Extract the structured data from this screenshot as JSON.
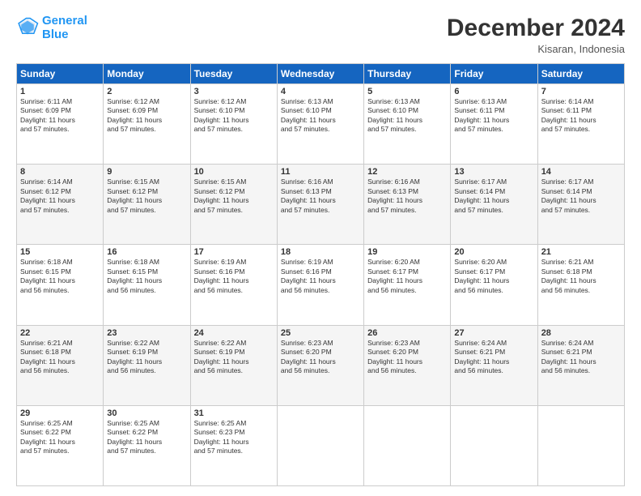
{
  "logo": {
    "line1": "General",
    "line2": "Blue",
    "icon_color": "#2196F3"
  },
  "title": "December 2024",
  "subtitle": "Kisaran, Indonesia",
  "headers": [
    "Sunday",
    "Monday",
    "Tuesday",
    "Wednesday",
    "Thursday",
    "Friday",
    "Saturday"
  ],
  "weeks": [
    [
      {
        "day": "1",
        "sunrise": "6:11 AM",
        "sunset": "6:09 PM",
        "daylight": "11 hours and 57 minutes."
      },
      {
        "day": "2",
        "sunrise": "6:12 AM",
        "sunset": "6:09 PM",
        "daylight": "11 hours and 57 minutes."
      },
      {
        "day": "3",
        "sunrise": "6:12 AM",
        "sunset": "6:10 PM",
        "daylight": "11 hours and 57 minutes."
      },
      {
        "day": "4",
        "sunrise": "6:13 AM",
        "sunset": "6:10 PM",
        "daylight": "11 hours and 57 minutes."
      },
      {
        "day": "5",
        "sunrise": "6:13 AM",
        "sunset": "6:10 PM",
        "daylight": "11 hours and 57 minutes."
      },
      {
        "day": "6",
        "sunrise": "6:13 AM",
        "sunset": "6:11 PM",
        "daylight": "11 hours and 57 minutes."
      },
      {
        "day": "7",
        "sunrise": "6:14 AM",
        "sunset": "6:11 PM",
        "daylight": "11 hours and 57 minutes."
      }
    ],
    [
      {
        "day": "8",
        "sunrise": "6:14 AM",
        "sunset": "6:12 PM",
        "daylight": "11 hours and 57 minutes."
      },
      {
        "day": "9",
        "sunrise": "6:15 AM",
        "sunset": "6:12 PM",
        "daylight": "11 hours and 57 minutes."
      },
      {
        "day": "10",
        "sunrise": "6:15 AM",
        "sunset": "6:12 PM",
        "daylight": "11 hours and 57 minutes."
      },
      {
        "day": "11",
        "sunrise": "6:16 AM",
        "sunset": "6:13 PM",
        "daylight": "11 hours and 57 minutes."
      },
      {
        "day": "12",
        "sunrise": "6:16 AM",
        "sunset": "6:13 PM",
        "daylight": "11 hours and 57 minutes."
      },
      {
        "day": "13",
        "sunrise": "6:17 AM",
        "sunset": "6:14 PM",
        "daylight": "11 hours and 57 minutes."
      },
      {
        "day": "14",
        "sunrise": "6:17 AM",
        "sunset": "6:14 PM",
        "daylight": "11 hours and 57 minutes."
      }
    ],
    [
      {
        "day": "15",
        "sunrise": "6:18 AM",
        "sunset": "6:15 PM",
        "daylight": "11 hours and 56 minutes."
      },
      {
        "day": "16",
        "sunrise": "6:18 AM",
        "sunset": "6:15 PM",
        "daylight": "11 hours and 56 minutes."
      },
      {
        "day": "17",
        "sunrise": "6:19 AM",
        "sunset": "6:16 PM",
        "daylight": "11 hours and 56 minutes."
      },
      {
        "day": "18",
        "sunrise": "6:19 AM",
        "sunset": "6:16 PM",
        "daylight": "11 hours and 56 minutes."
      },
      {
        "day": "19",
        "sunrise": "6:20 AM",
        "sunset": "6:17 PM",
        "daylight": "11 hours and 56 minutes."
      },
      {
        "day": "20",
        "sunrise": "6:20 AM",
        "sunset": "6:17 PM",
        "daylight": "11 hours and 56 minutes."
      },
      {
        "day": "21",
        "sunrise": "6:21 AM",
        "sunset": "6:18 PM",
        "daylight": "11 hours and 56 minutes."
      }
    ],
    [
      {
        "day": "22",
        "sunrise": "6:21 AM",
        "sunset": "6:18 PM",
        "daylight": "11 hours and 56 minutes."
      },
      {
        "day": "23",
        "sunrise": "6:22 AM",
        "sunset": "6:19 PM",
        "daylight": "11 hours and 56 minutes."
      },
      {
        "day": "24",
        "sunrise": "6:22 AM",
        "sunset": "6:19 PM",
        "daylight": "11 hours and 56 minutes."
      },
      {
        "day": "25",
        "sunrise": "6:23 AM",
        "sunset": "6:20 PM",
        "daylight": "11 hours and 56 minutes."
      },
      {
        "day": "26",
        "sunrise": "6:23 AM",
        "sunset": "6:20 PM",
        "daylight": "11 hours and 56 minutes."
      },
      {
        "day": "27",
        "sunrise": "6:24 AM",
        "sunset": "6:21 PM",
        "daylight": "11 hours and 56 minutes."
      },
      {
        "day": "28",
        "sunrise": "6:24 AM",
        "sunset": "6:21 PM",
        "daylight": "11 hours and 56 minutes."
      }
    ],
    [
      {
        "day": "29",
        "sunrise": "6:25 AM",
        "sunset": "6:22 PM",
        "daylight": "11 hours and 57 minutes."
      },
      {
        "day": "30",
        "sunrise": "6:25 AM",
        "sunset": "6:22 PM",
        "daylight": "11 hours and 57 minutes."
      },
      {
        "day": "31",
        "sunrise": "6:25 AM",
        "sunset": "6:23 PM",
        "daylight": "11 hours and 57 minutes."
      },
      null,
      null,
      null,
      null
    ]
  ]
}
